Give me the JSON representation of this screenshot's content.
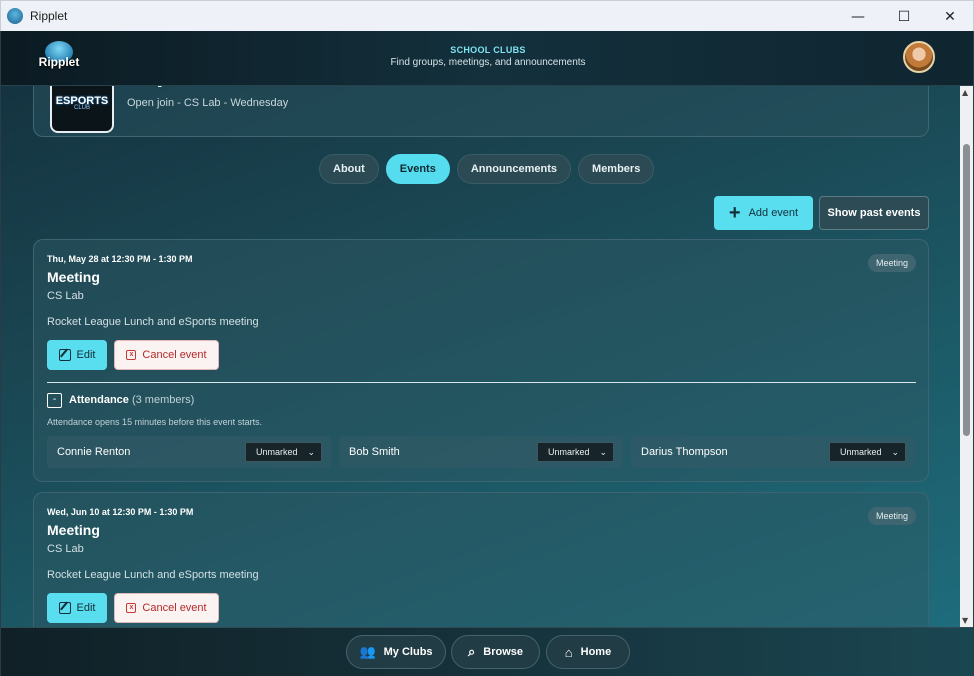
{
  "window": {
    "title": "Ripplet",
    "minimize": "—",
    "maximize": "☐",
    "close": "✕"
  },
  "header": {
    "logo_text": "Ripplet",
    "title": "SCHOOL CLUBS",
    "subtitle": "Find groups, meetings, and announcements"
  },
  "club": {
    "name": "eSports",
    "meta": "Open join - CS Lab - Wednesday",
    "badge_line1": "ESPORTS",
    "badge_line2": "CLUB"
  },
  "tabs": [
    {
      "label": "About",
      "active": false
    },
    {
      "label": "Events",
      "active": true
    },
    {
      "label": "Announcements",
      "active": false
    },
    {
      "label": "Members",
      "active": false
    }
  ],
  "actions": {
    "add_event": "Add event",
    "show_past": "Show past events"
  },
  "events": [
    {
      "date": "Thu, May 28 at 12:30 PM - 1:30 PM",
      "title": "Meeting",
      "location": "CS Lab",
      "description": "Rocket League Lunch and eSports meeting",
      "badge": "Meeting",
      "edit": "Edit",
      "cancel": "Cancel event",
      "attendance": {
        "toggle": "-",
        "label": "Attendance",
        "count": "(3 members)",
        "note": "Attendance opens 15 minutes before this event starts.",
        "members": [
          {
            "name": "Connie Renton",
            "status": "Unmarked"
          },
          {
            "name": "Bob Smith",
            "status": "Unmarked"
          },
          {
            "name": "Darius Thompson",
            "status": "Unmarked"
          }
        ]
      }
    },
    {
      "date": "Wed, Jun 10 at 12:30 PM - 1:30 PM",
      "title": "Meeting",
      "location": "CS Lab",
      "description": "Rocket League Lunch and eSports meeting",
      "badge": "Meeting",
      "edit": "Edit",
      "cancel": "Cancel event"
    }
  ],
  "bottom_nav": [
    {
      "label": "My Clubs",
      "icon": "people-icon"
    },
    {
      "label": "Browse",
      "icon": "search-icon"
    },
    {
      "label": "Home",
      "icon": "home-icon"
    }
  ]
}
